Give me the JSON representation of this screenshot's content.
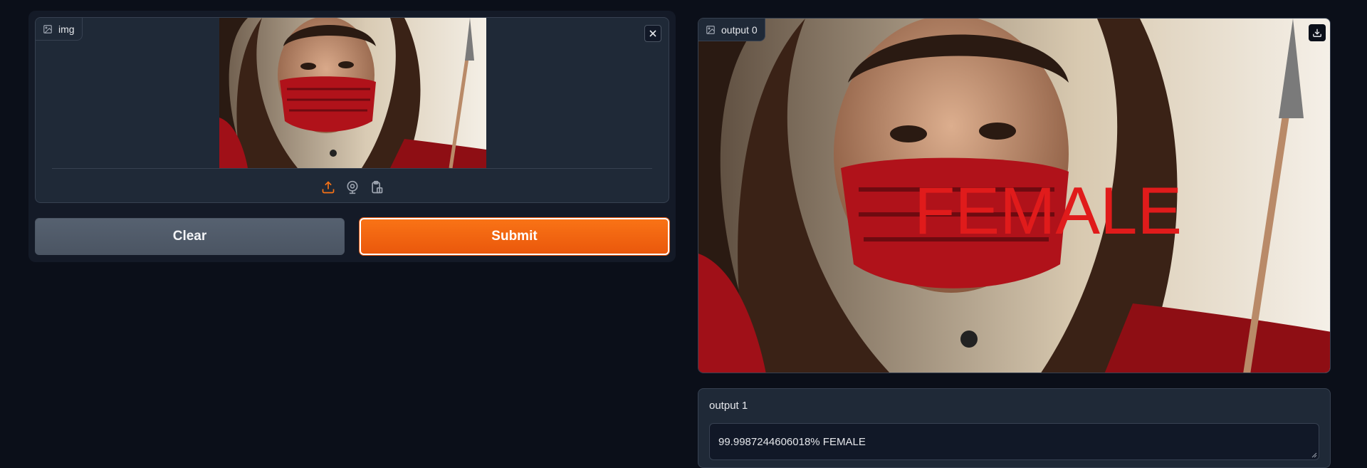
{
  "input": {
    "label": "img",
    "image_alt": "woman with red face mask and spear",
    "icons": {
      "label": "image-icon",
      "close": "close-icon",
      "upload": "upload-icon",
      "webcam": "webcam-icon",
      "clipboard": "clipboard-icon"
    }
  },
  "buttons": {
    "clear_label": "Clear",
    "submit_label": "Submit"
  },
  "output0": {
    "label": "output 0",
    "image_overlay_text": "FEMALE",
    "icons": {
      "label": "image-icon",
      "download": "download-icon"
    }
  },
  "output1": {
    "label": "output 1",
    "value": "99.9987244606018% FEMALE"
  },
  "colors": {
    "background": "#0b0f19",
    "panel": "#1f2937",
    "accent": "#f97316",
    "overlay_text": "#e01b1b"
  }
}
